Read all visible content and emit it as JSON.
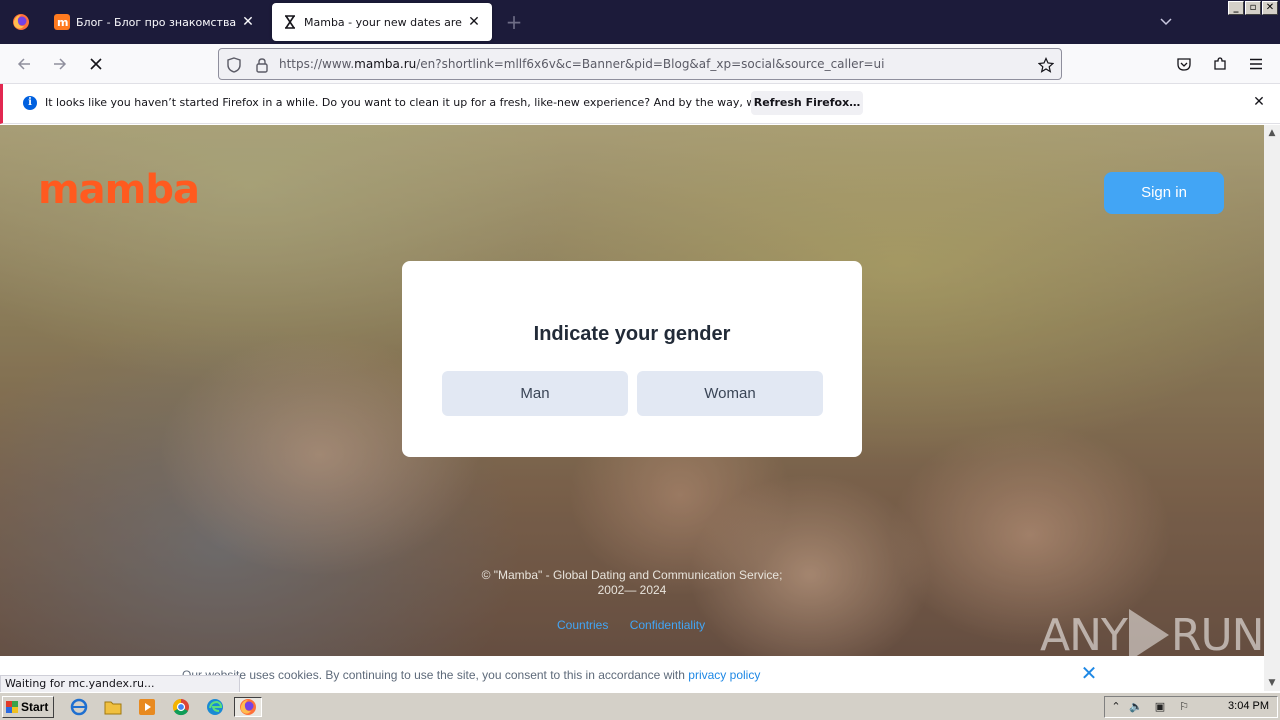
{
  "browser": {
    "tabs": [
      {
        "title": "Блог - Блог про знакомства и отношения",
        "active": false
      },
      {
        "title": "Mamba - your new dates are here",
        "active": true
      }
    ],
    "url_prefix": "https://www.",
    "url_domain": "mamba.ru",
    "url_rest": "/en?shortlink=mllf6x6v&c=Banner&pid=Blog&af_xp=social&source_caller=ui",
    "status_text": "Waiting for mc.yandex.ru..."
  },
  "notification": {
    "message": "It looks like you haven’t started Firefox in a while. Do you want to clean it up for a fresh, like-new experience? And by the way, welcome back!",
    "button_label": "Refresh Firefox…"
  },
  "page": {
    "logo": "mamba",
    "signin_label": "Sign in",
    "modal": {
      "title": "Indicate your gender",
      "options": [
        "Man",
        "Woman"
      ]
    },
    "footer_line1": "© \"Mamba\" - Global Dating and Communication Service;",
    "footer_line2": "2002— 2024",
    "footer_links": [
      "Countries",
      "Confidentiality"
    ],
    "cookie_text": "Our website uses cookies. By continuing to use the site, you consent to this in accordance with",
    "cookie_link": "privacy policy"
  },
  "watermark": {
    "left": "ANY",
    "right": "RUN"
  },
  "taskbar": {
    "start_label": "Start",
    "clock": "3:04 PM"
  },
  "colors": {
    "brand_orange": "#ff5a1f",
    "accent_blue": "#42a5f5",
    "tab_strip": "#1c1b3a"
  }
}
